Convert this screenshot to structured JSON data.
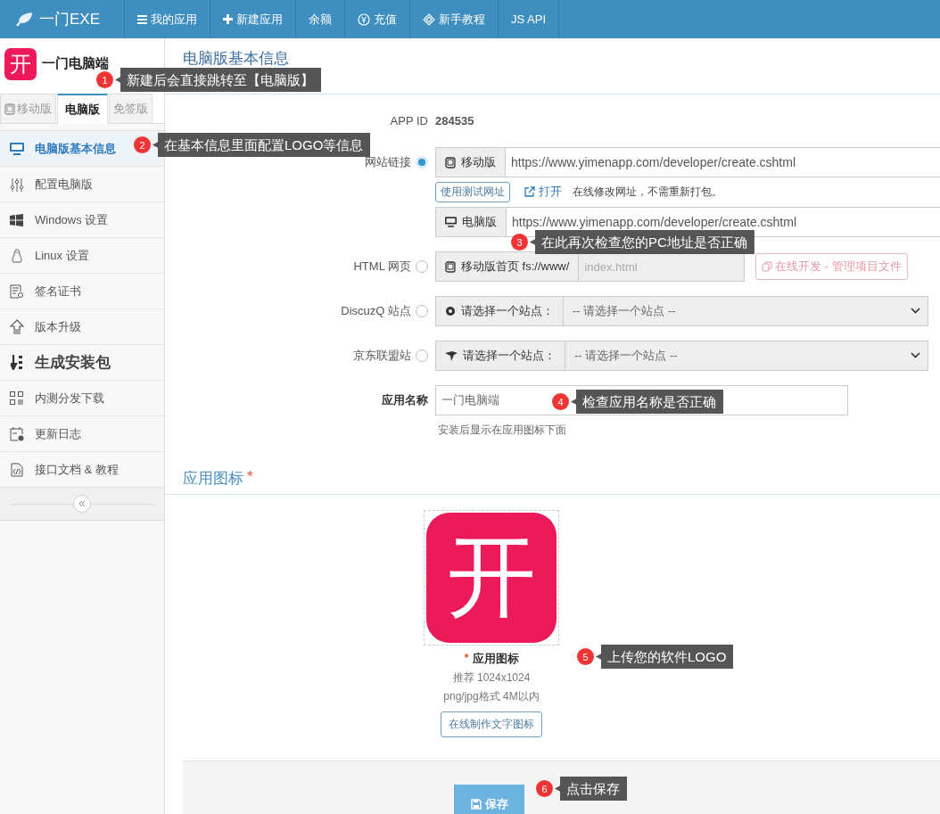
{
  "top_nav": {
    "brand": "一门EXE",
    "items": [
      {
        "label": "我的应用"
      },
      {
        "label": "新建应用"
      },
      {
        "label": "余额"
      },
      {
        "label": "充值"
      },
      {
        "label": "新手教程"
      },
      {
        "label": "JS API"
      }
    ]
  },
  "sidebar": {
    "app_icon_text": "开",
    "app_name": "一门电脑端",
    "tabs": [
      {
        "label": "移动版",
        "selected": false
      },
      {
        "label": "电脑版",
        "selected": true
      },
      {
        "label": "免签版",
        "selected": false
      }
    ],
    "menu": [
      {
        "label": "电脑版基本信息",
        "selected": true,
        "kind": "link"
      },
      {
        "label": "配置电脑版",
        "selected": false,
        "kind": "link"
      },
      {
        "label": "Windows 设置",
        "selected": false,
        "kind": "link"
      },
      {
        "label": "Linux 设置",
        "selected": false,
        "kind": "link"
      },
      {
        "label": "签名证书",
        "selected": false,
        "kind": "link"
      },
      {
        "label": "版本升级",
        "selected": false,
        "kind": "link"
      },
      {
        "label": "生成安装包",
        "selected": false,
        "kind": "action"
      },
      {
        "label": "内测分发下载",
        "selected": false,
        "kind": "link"
      },
      {
        "label": "更新日志",
        "selected": false,
        "kind": "link"
      },
      {
        "label": "接口文档 & 教程",
        "selected": false,
        "kind": "link"
      }
    ]
  },
  "main": {
    "title": "电脑版基本信息",
    "app_id": {
      "label": "APP ID",
      "value": "284535"
    },
    "website": {
      "label": "网站链接",
      "selected": true,
      "mobile": {
        "addon": "移动版",
        "value": "https://www.yimenapp.com/developer/create.cshtml"
      },
      "test_button": "使用测试网址",
      "open_link": "打开",
      "note": "在线修改网址，不需重新打包。",
      "desktop": {
        "addon": "电脑版",
        "value": "https://www.yimenapp.com/developer/create.cshtml"
      }
    },
    "html": {
      "label": "HTML 网页",
      "selected": false,
      "addon": "移动版首页 fs://www/",
      "placeholder": "index.html",
      "disabled": true,
      "dev_button": "在线开发 - 管理项目文件"
    },
    "sites": [
      {
        "label": "DiscuzQ 站点",
        "selected": false,
        "addon": "请选择一个站点：",
        "select": "-- 请选择一个站点 --"
      },
      {
        "label": "京东联盟站",
        "selected": false,
        "addon": "请选择一个站点：",
        "select": "-- 请选择一个站点 --"
      }
    ],
    "app_name": {
      "label": "应用名称",
      "value": "一门电脑端",
      "hint": "安装后显示在应用图标下面"
    },
    "icon_section": {
      "title": "应用图标",
      "required_mark": "*",
      "icon_text": "开",
      "caption": "应用图标",
      "hints": [
        "推荐 1024x1024",
        "png/jpg格式 4M以内"
      ],
      "make_button": "在线制作文字图标"
    },
    "save_button": "保存"
  },
  "callouts": [
    {
      "number": "1",
      "text": "新建后会直接跳转至【电脑版】"
    },
    {
      "number": "2",
      "text": "在基本信息里面配置LOGO等信息"
    },
    {
      "number": "3",
      "text": "在此再次检查您的PC地址是否正确"
    },
    {
      "number": "4",
      "text": "检查应用名称是否正确"
    },
    {
      "number": "5",
      "text": "上传您的软件LOGO"
    },
    {
      "number": "6",
      "text": "点击保存"
    }
  ]
}
